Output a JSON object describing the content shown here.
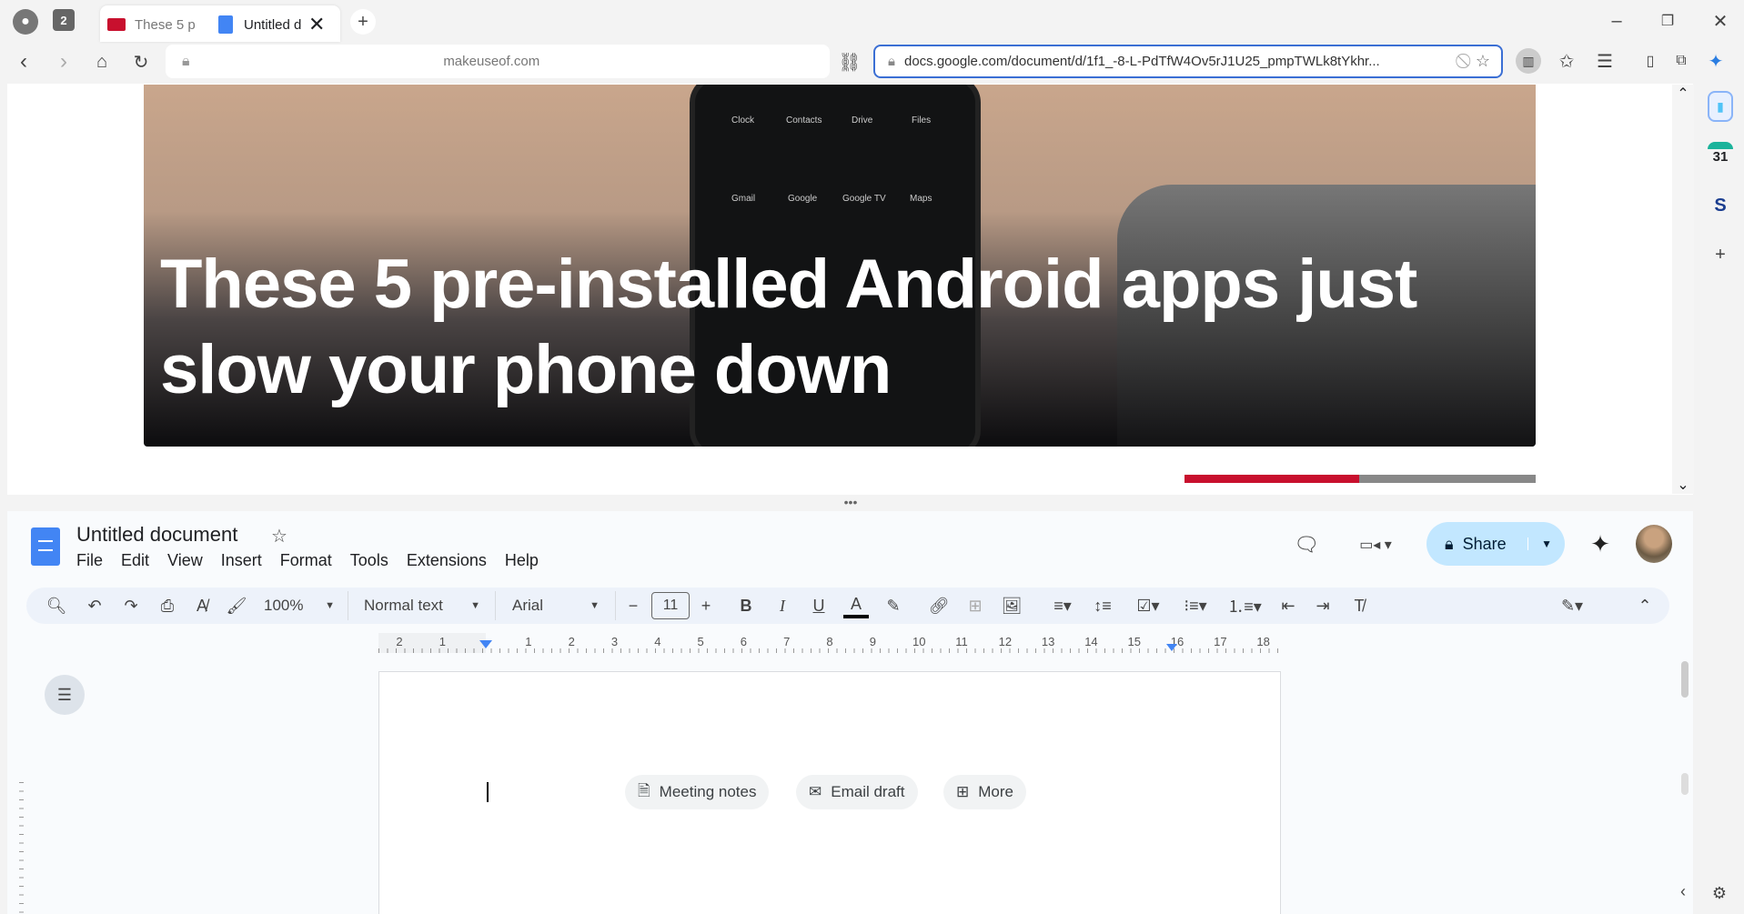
{
  "browser": {
    "tabs": [
      {
        "label": "These 5 p",
        "favicon": "muo-icon"
      },
      {
        "label": "Untitled d",
        "favicon": "docs-icon",
        "active": true
      }
    ],
    "tab_count": "2",
    "left_url": "makeuseof.com",
    "right_url": "docs.google.com/document/d/1f1_-8-L-PdTfW4Ov5rJ1U25_pmpTWLk8tYkhr...",
    "sidebar": {
      "calendar_day": "31",
      "s_label": "S"
    }
  },
  "article": {
    "headline_line1": "These 5 pre-installed Android apps just",
    "headline_line2": "slow your phone down",
    "app_labels": [
      "Clock",
      "Contacts",
      "Drive",
      "Files",
      "Gmail",
      "Google",
      "Google TV",
      "Maps"
    ]
  },
  "docs": {
    "title": "Untitled document",
    "menu": [
      "File",
      "Edit",
      "View",
      "Insert",
      "Format",
      "Tools",
      "Extensions",
      "Help"
    ],
    "share_label": "Share",
    "zoom": "100%",
    "style": "Normal text",
    "font": "Arial",
    "font_size": "11",
    "ruler_left": [
      "2",
      "1"
    ],
    "ruler": [
      "1",
      "2",
      "3",
      "4",
      "5",
      "6",
      "7",
      "8",
      "9",
      "10",
      "11",
      "12",
      "13",
      "14",
      "15",
      "16",
      "17",
      "18"
    ],
    "chips": [
      "Meeting notes",
      "Email draft",
      "More"
    ],
    "accent": "#1a73e8",
    "share_bg": "#c2e7ff"
  }
}
